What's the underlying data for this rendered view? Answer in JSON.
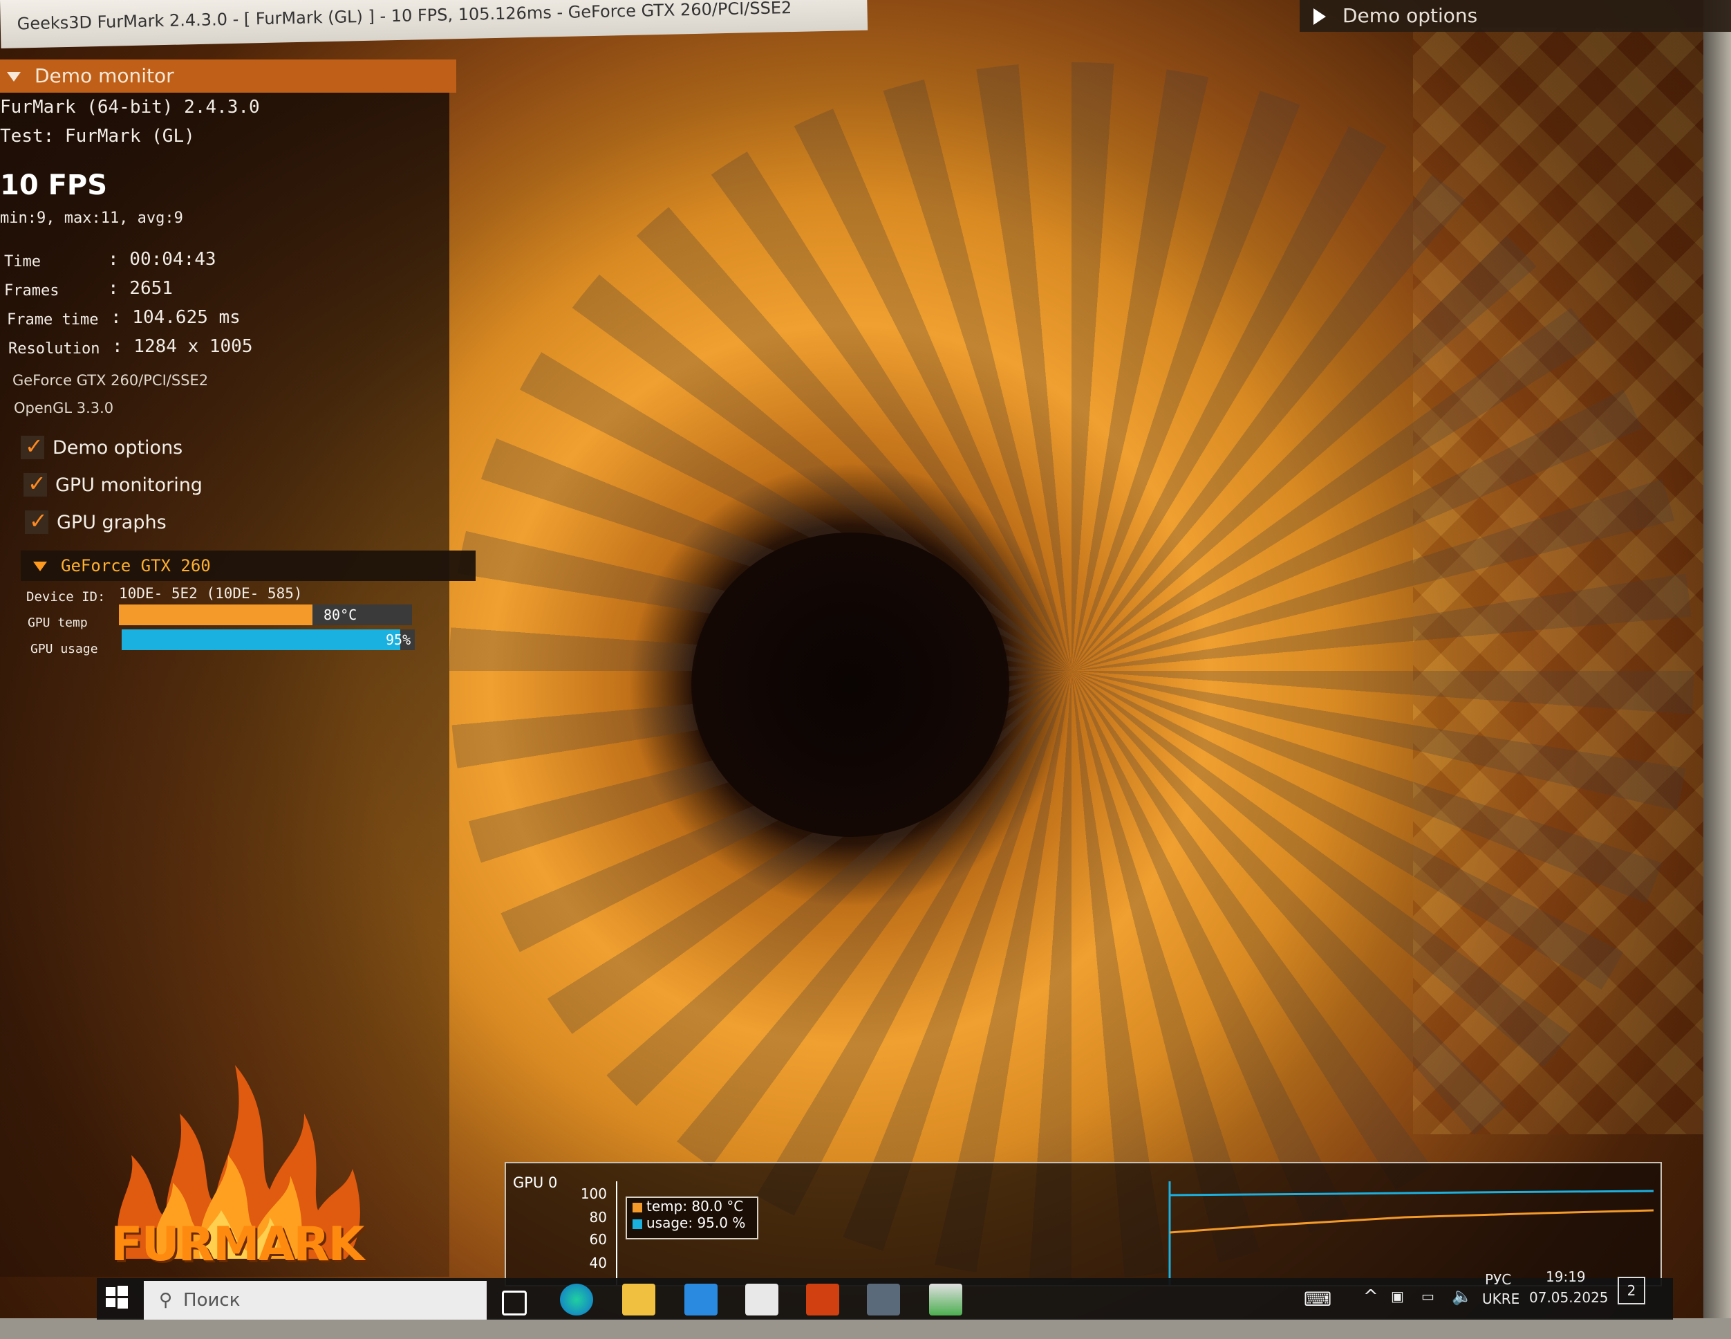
{
  "window": {
    "title": "Geeks3D FurMark 2.4.3.0 - [ FurMark (GL) ] - 10 FPS, 105.126ms - GeForce GTX 260/PCI/SSE2"
  },
  "demo_options_button": {
    "label": "Demo options"
  },
  "demo_monitor": {
    "header": "Demo monitor",
    "app_line": "FurMark (64-bit) 2.4.3.0",
    "test_line": "Test: FurMark (GL)",
    "fps": "10 FPS",
    "fps_stats": "min:9, max:11, avg:9",
    "stats": [
      {
        "label": "Time",
        "value": ": 00:04:43"
      },
      {
        "label": "Frames",
        "value": ": 2651"
      },
      {
        "label": "Frame time",
        "value": ": 104.625 ms"
      },
      {
        "label": "Resolution",
        "value": ": 1284 x 1005"
      }
    ],
    "renderer": "GeForce GTX 260/PCI/SSE2",
    "opengl": "OpenGL 3.3.0",
    "checkboxes": [
      {
        "label": "Demo options",
        "checked": true
      },
      {
        "label": "GPU monitoring",
        "checked": true
      },
      {
        "label": "GPU graphs",
        "checked": true
      }
    ]
  },
  "gpu": {
    "name": "GeForce GTX 260",
    "device_label": "Device ID:",
    "device_id": "10DE- 5E2 (10DE- 585)",
    "temp_label": "GPU temp",
    "temp_value": "80°C",
    "temp_fraction": 0.66,
    "usage_label": "GPU usage",
    "usage_value": "95%",
    "usage_fraction": 0.95,
    "temp_color": "#f39a2a",
    "usage_color": "#1ab0e0"
  },
  "logo": {
    "text": "FURMARK"
  },
  "graph": {
    "title": "GPU 0",
    "ticks": [
      "100",
      "80",
      "60",
      "40"
    ],
    "legend_temp": "temp: 80.0 °C",
    "legend_usage": "usage: 95.0 %"
  },
  "taskbar": {
    "search_placeholder": "Поиск",
    "lang_top": "РУС",
    "lang_bottom": "UKRE",
    "time": "19:19",
    "date": "07.05.2025",
    "notification_count": "2"
  }
}
